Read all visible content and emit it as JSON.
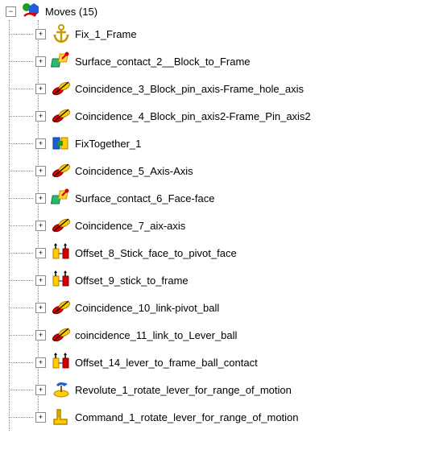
{
  "root": {
    "label": "Moves",
    "count": "(15)",
    "expander": "−"
  },
  "items": [
    {
      "label": "Fix_1_Frame",
      "icon": "anchor",
      "expander": "+"
    },
    {
      "label": "Surface_contact_2__Block_to_Frame",
      "icon": "surface",
      "expander": "+"
    },
    {
      "label": "Coincidence_3_Block_pin_axis-Frame_hole_axis",
      "icon": "coincidence",
      "expander": "+"
    },
    {
      "label": "Coincidence_4_Block_pin_axis2-Frame_Pin_axis2",
      "icon": "coincidence",
      "expander": "+"
    },
    {
      "label": "FixTogether_1",
      "icon": "fixtogether",
      "expander": "+"
    },
    {
      "label": "Coincidence_5_Axis-Axis",
      "icon": "coincidence",
      "expander": "+"
    },
    {
      "label": "Surface_contact_6_Face-face",
      "icon": "surface",
      "expander": "+"
    },
    {
      "label": "Coincidence_7_aix-axis",
      "icon": "coincidence",
      "expander": "+"
    },
    {
      "label": "Offset_8_Stick_face_to_pivot_face",
      "icon": "offset",
      "expander": "+"
    },
    {
      "label": "Offset_9_stick_to_frame",
      "icon": "offset",
      "expander": "+"
    },
    {
      "label": "Coincidence_10_link-pivot_ball",
      "icon": "coincidence",
      "expander": "+"
    },
    {
      "label": "coincidence_11_link_to_Lever_ball",
      "icon": "coincidence",
      "expander": "+"
    },
    {
      "label": "Offset_14_lever_to_frame_ball_contact",
      "icon": "offset",
      "expander": "+"
    },
    {
      "label": "Revolute_1_rotate_lever_for_range_of_motion",
      "icon": "revolute",
      "expander": "+"
    },
    {
      "label": "Command_1_rotate_lever_for_range_of_motion",
      "icon": "command",
      "expander": "+"
    }
  ]
}
